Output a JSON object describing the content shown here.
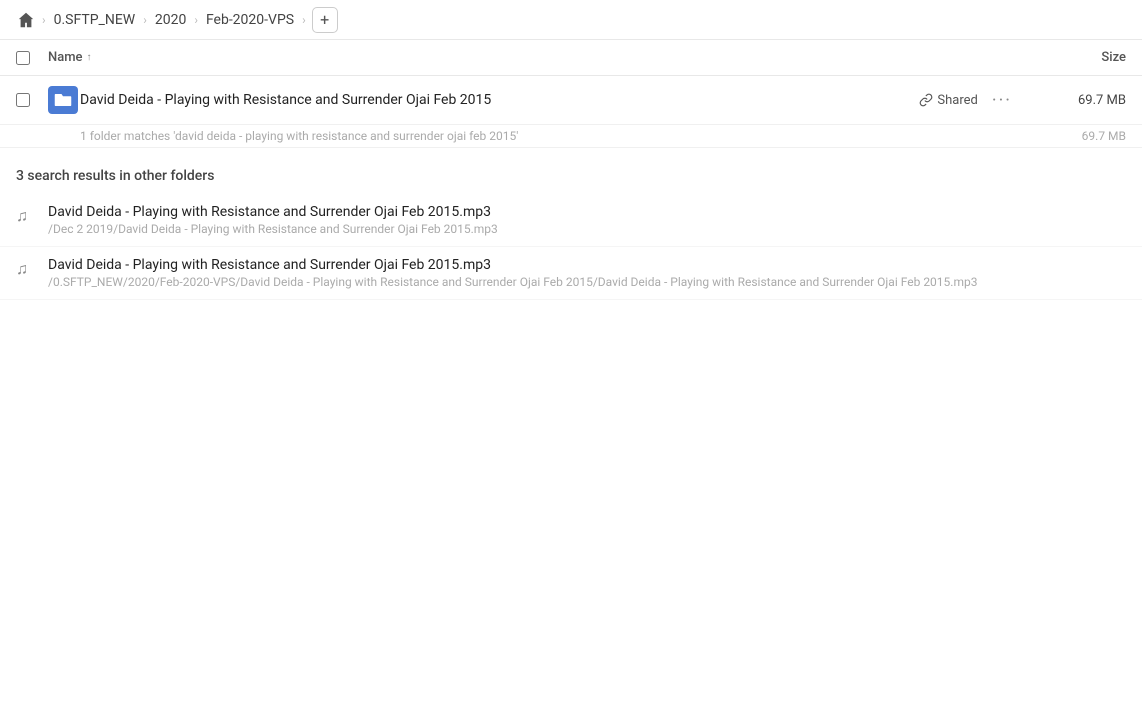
{
  "breadcrumb": {
    "home_label": "home",
    "items": [
      {
        "label": "0.SFTP_NEW",
        "id": "sftp-new"
      },
      {
        "label": "2020",
        "id": "2020"
      },
      {
        "label": "Feb-2020-VPS",
        "id": "feb-2020-vps"
      }
    ],
    "add_label": "+"
  },
  "table_header": {
    "name_label": "Name",
    "sort_arrow": "↑",
    "size_label": "Size"
  },
  "main_result": {
    "folder_name": "David Deida - Playing with Resistance and Surrender Ojai Feb 2015",
    "shared_label": "Shared",
    "size": "69.7 MB",
    "match_count_text": "1 folder matches 'david deida - playing with resistance and surrender ojai feb 2015'",
    "match_size": "69.7 MB"
  },
  "other_folders_section": {
    "heading": "3 search results in other folders",
    "results": [
      {
        "name": "David Deida - Playing with Resistance and Surrender Ojai Feb 2015.mp3",
        "path": "/Dec 2 2019/David Deida - Playing with Resistance and Surrender Ojai Feb 2015.mp3"
      },
      {
        "name": "David Deida - Playing with Resistance and Surrender Ojai Feb 2015.mp3",
        "path": "/0.SFTP_NEW/2020/Feb-2020-VPS/David Deida - Playing with Resistance and Surrender Ojai Feb 2015/David Deida - Playing with Resistance and Surrender Ojai Feb 2015.mp3"
      }
    ]
  },
  "icons": {
    "home": "⌂",
    "music_note": "♫",
    "link": "🔗",
    "more": "···",
    "chevron_right": "›"
  }
}
